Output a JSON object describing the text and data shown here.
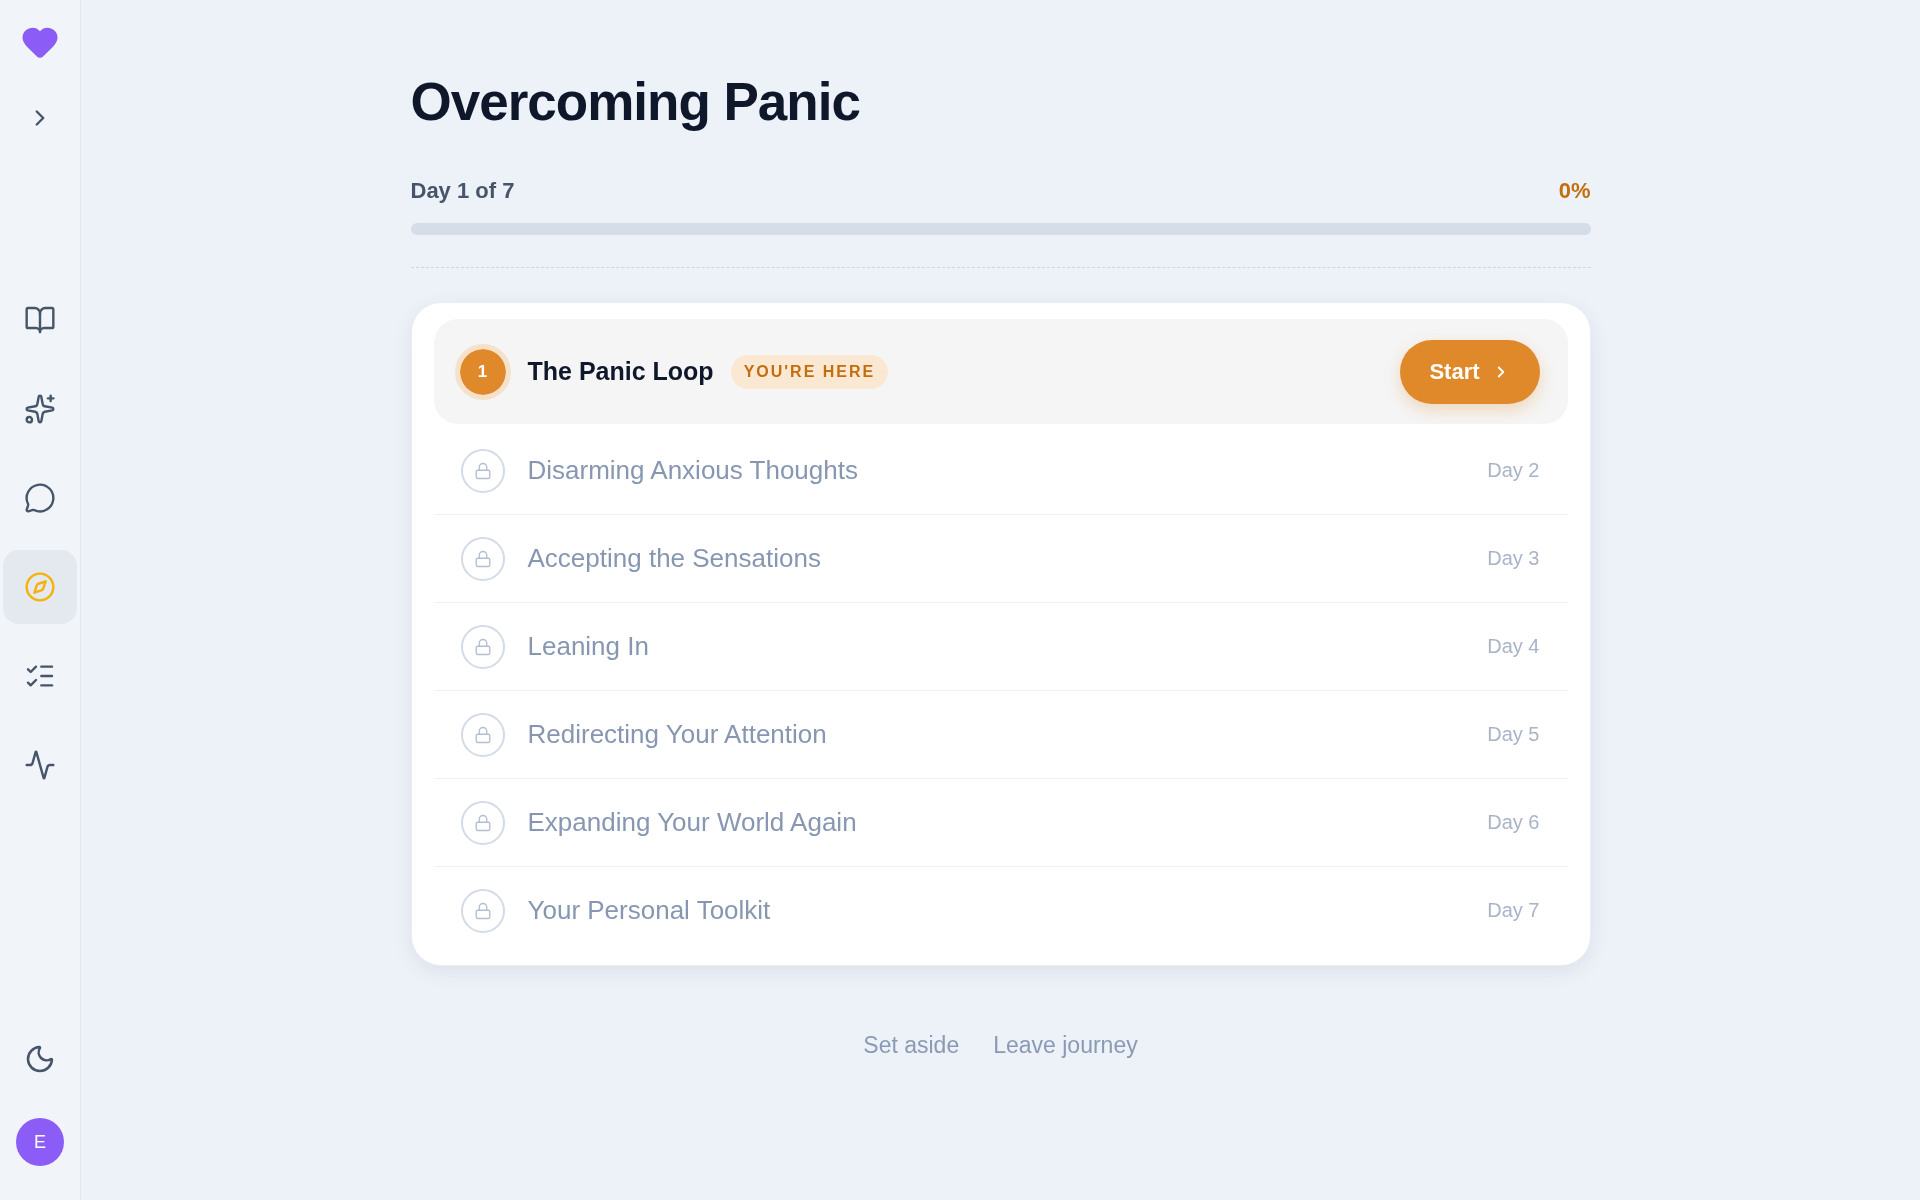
{
  "sidebar": {
    "nav_items": [
      {
        "selected": false
      },
      {
        "selected": false
      },
      {
        "selected": false
      },
      {
        "selected": true
      },
      {
        "selected": false
      },
      {
        "selected": false
      }
    ],
    "avatar": {
      "initial": "E"
    }
  },
  "journey": {
    "title": "Overcoming Panic",
    "progress": {
      "label": "Day 1 of 7",
      "percent": "0%"
    },
    "lessons": [
      {
        "kind": "current",
        "number": "1",
        "title": "The Panic Loop",
        "badge": "YOU'RE HERE",
        "action": "Start"
      },
      {
        "kind": "locked",
        "title": "Disarming Anxious Thoughts",
        "day": "Day 2"
      },
      {
        "kind": "locked",
        "title": "Accepting the Sensations",
        "day": "Day 3"
      },
      {
        "kind": "locked",
        "title": "Leaning In",
        "day": "Day 4"
      },
      {
        "kind": "locked",
        "title": "Redirecting Your Attention",
        "day": "Day 5"
      },
      {
        "kind": "locked",
        "title": "Expanding Your World Again",
        "day": "Day 6"
      },
      {
        "kind": "locked",
        "title": "Your Personal Toolkit",
        "day": "Day 7"
      }
    ]
  },
  "footer_links": [
    "Set aside",
    "Leave journey"
  ]
}
